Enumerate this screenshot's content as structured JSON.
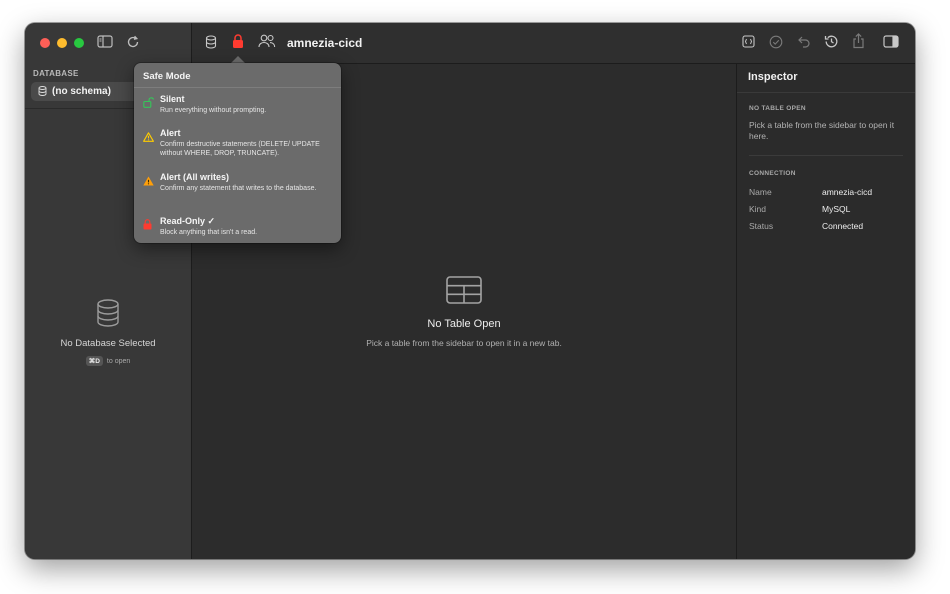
{
  "sidebar": {
    "section_label": "DATABASE",
    "schema_label": "(no schema)",
    "empty_title": "No Database Selected",
    "shortcut_key": "⌘D",
    "shortcut_hint": "to open"
  },
  "toolbar": {
    "connection_title": "amnezia-cicd"
  },
  "main": {
    "empty_title": "No Table Open",
    "empty_subtitle": "Pick a table from the sidebar to open it in a new tab."
  },
  "inspector": {
    "title": "Inspector",
    "no_table_heading": "NO TABLE OPEN",
    "no_table_text": "Pick a table from the sidebar to open it here.",
    "connection_heading": "CONNECTION",
    "rows": [
      {
        "key": "Name",
        "value": "amnezia-cicd"
      },
      {
        "key": "Kind",
        "value": "MySQL"
      },
      {
        "key": "Status",
        "value": "Connected"
      }
    ]
  },
  "popover": {
    "title": "Safe Mode",
    "options": [
      {
        "name": "Silent",
        "description": "Run everything without prompting.",
        "icon": "unlocked-icon",
        "color": "#34c759"
      },
      {
        "name": "Alert",
        "description": "Confirm destructive statements (DELETE/ UPDATE without WHERE, DROP, TRUNCATE).",
        "icon": "warning-outline-icon",
        "color": "#ffcc00"
      },
      {
        "name": "Alert (All writes)",
        "description": "Confirm any statement that writes to the database.",
        "icon": "warning-filled-icon",
        "color": "#ff9f0a"
      },
      {
        "name": "Read-Only ✓",
        "description": "Block anything that isn't a read.",
        "icon": "lock-icon",
        "color": "#ff3b30"
      }
    ]
  },
  "colors": {
    "accent_red": "#ff3b30",
    "window_bg": "#2c2c2c",
    "sidebar_bg": "#383838",
    "popover_bg": "#6b6b6b"
  }
}
